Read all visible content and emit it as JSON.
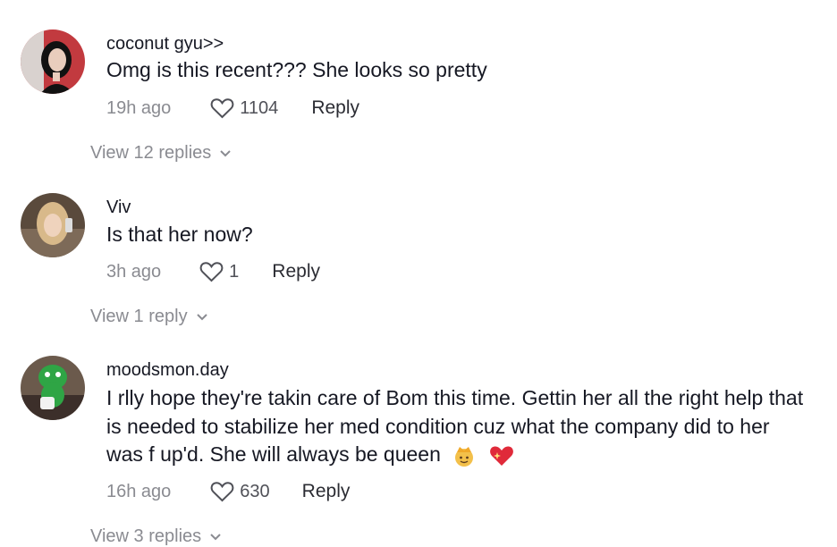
{
  "comments": [
    {
      "username": "coconut gyu>>",
      "text": "Omg is this recent??? She looks so pretty",
      "time": "19h ago",
      "likes": "1104",
      "reply_label": "Reply",
      "view_replies": "View 12 replies",
      "avatar_desc": "woman-with-dark-hair-red-background"
    },
    {
      "username": "Viv",
      "text": "Is that her now?",
      "time": "3h ago",
      "likes": "1",
      "reply_label": "Reply",
      "view_replies": "View 1 reply",
      "avatar_desc": "blonde-woman-selfie"
    },
    {
      "username": "moodsmon.day",
      "text": "I rlly hope they're takin care of Bom this time. Gettin her all the right help that is needed to stabilize her med condition cuz what the company did to her was f up'd. She will always be queen",
      "emoji": [
        "crown-princess-emoji",
        "sparkling-heart-emoji"
      ],
      "time": "16h ago",
      "likes": "630",
      "reply_label": "Reply",
      "view_replies": "View 3 replies",
      "avatar_desc": "green-toy-figure-with-mug"
    }
  ],
  "icons": {
    "like": "heart-outline-icon",
    "expand": "chevron-down-icon"
  },
  "colors": {
    "text": "#161823",
    "secondary": "#8a8b91",
    "background": "#ffffff"
  }
}
